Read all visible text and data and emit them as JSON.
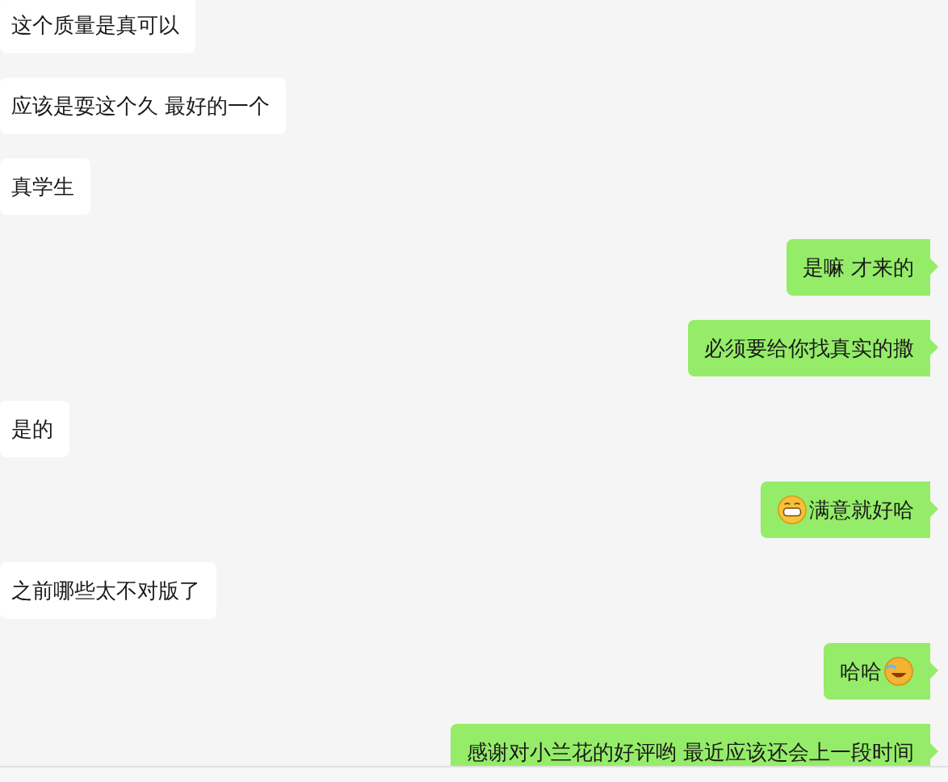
{
  "messages": [
    {
      "kind": "received",
      "parts": [
        {
          "kind": "text",
          "text": "这个质量是真可以"
        }
      ]
    },
    {
      "kind": "received",
      "parts": [
        {
          "kind": "text",
          "text": "应该是耍这个久 最好的一个"
        }
      ]
    },
    {
      "kind": "received",
      "parts": [
        {
          "kind": "text",
          "text": "真学生"
        }
      ]
    },
    {
      "kind": "sent",
      "parts": [
        {
          "kind": "text",
          "text": "是嘛 才来的"
        }
      ]
    },
    {
      "kind": "sent",
      "parts": [
        {
          "kind": "text",
          "text": "必须要给你找真实的撒"
        }
      ]
    },
    {
      "kind": "received",
      "parts": [
        {
          "kind": "text",
          "text": "是的"
        }
      ]
    },
    {
      "kind": "sent",
      "parts": [
        {
          "kind": "grin"
        },
        {
          "kind": "text",
          "text": "满意就好哈"
        }
      ]
    },
    {
      "kind": "received",
      "parts": [
        {
          "kind": "text",
          "text": "之前哪些太不对版了"
        }
      ]
    },
    {
      "kind": "sent",
      "parts": [
        {
          "kind": "text",
          "text": "哈哈"
        },
        {
          "kind": "laugh"
        }
      ]
    },
    {
      "kind": "sent",
      "parts": [
        {
          "kind": "text",
          "text": "感谢对小兰花的好评哟 最近应该还会上一段时间"
        }
      ]
    }
  ]
}
